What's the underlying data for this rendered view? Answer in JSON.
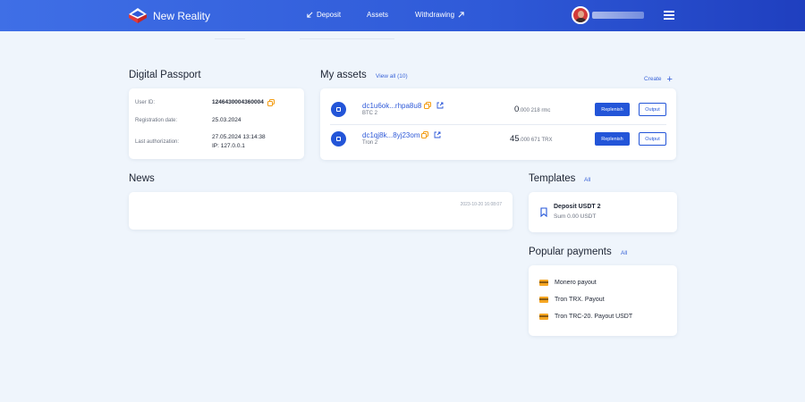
{
  "header": {
    "brand": "New Reality",
    "nav": [
      {
        "label": "Deposit",
        "icon": "arrow-down-left-icon"
      },
      {
        "label": "Assets"
      },
      {
        "label": "Withdrawing",
        "icon": "arrow-up-right-icon"
      }
    ]
  },
  "passport": {
    "title": "Digital Passport",
    "rows": [
      {
        "label": "User ID:",
        "value": "1246430004360004"
      },
      {
        "label": "Registration date:",
        "value": "25.03.2024"
      },
      {
        "label": "Last authorization:",
        "value": "27.05.2024 13:14:38",
        "value2": "IP: 127.0.0.1"
      }
    ]
  },
  "assets": {
    "title": "My assets",
    "view_all": "View all (10)",
    "create": "Create",
    "items": [
      {
        "address": "dc1u6ok...rhpa8u8",
        "network": "BTC 2",
        "amount_int": "0",
        "amount_frac": ".000 218 rmc",
        "replenish": "Replenish",
        "output": "Output"
      },
      {
        "address": "dc1qj8k...8yj23om",
        "network": "Tron 2",
        "amount_int": "45",
        "amount_frac": ".000 671 TRX",
        "replenish": "Replenish",
        "output": "Output"
      }
    ]
  },
  "news": {
    "title": "News",
    "date": "2023-10-20 16:08:07"
  },
  "templates": {
    "title": "Templates",
    "all": "All",
    "item": {
      "name": "Deposit USDT 2",
      "sum": "Sum 0.00 USDT"
    }
  },
  "popular": {
    "title": "Popular payments",
    "all": "All",
    "items": [
      "Monero payout",
      "Tron TRX. Payout",
      "Tron TRC-20. Payout USDT"
    ]
  },
  "colors": {
    "accent": "#2355d8",
    "header_start": "#3f6fe6",
    "header_end": "#1f3fbf",
    "page_bg": "#eff5fc"
  }
}
